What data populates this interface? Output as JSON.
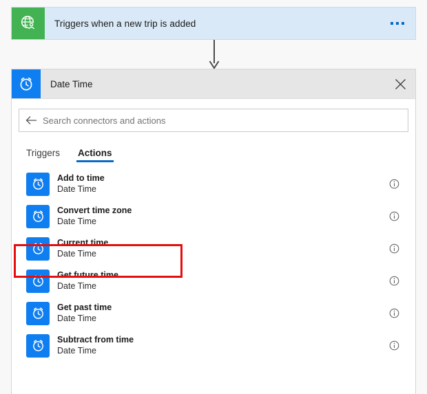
{
  "colors": {
    "trigger_card_bg": "#d9e9f7",
    "trigger_icon_bg": "#42b252",
    "connector_brand_blue": "#0f7ef0",
    "accent_blue": "#0a69c4",
    "annotation_red": "#e60d0d",
    "panel_header_bg": "#e6e6e6",
    "canvas_bg": "#f8f8f8"
  },
  "trigger": {
    "icon": "globe-person-icon",
    "title": "Triggers when a new trip is added",
    "menu_icon": "ellipsis-icon"
  },
  "connector": {
    "icon": "down-arrow-icon"
  },
  "panel": {
    "icon": "alarm-clock-icon",
    "title": "Date Time",
    "close_icon": "close-icon",
    "search": {
      "back_icon": "back-arrow-icon",
      "value": "",
      "placeholder": "Search connectors and actions"
    },
    "tabs": [
      {
        "label": "Triggers",
        "active": false
      },
      {
        "label": "Actions",
        "active": true
      }
    ],
    "actions": [
      {
        "name": "Add to time",
        "connector": "Date Time",
        "icon": "alarm-clock-icon",
        "info_icon": "info-icon",
        "highlighted": false
      },
      {
        "name": "Convert time zone",
        "connector": "Date Time",
        "icon": "alarm-clock-icon",
        "info_icon": "info-icon",
        "highlighted": false
      },
      {
        "name": "Current time",
        "connector": "Date Time",
        "icon": "alarm-clock-icon",
        "info_icon": "info-icon",
        "highlighted": true
      },
      {
        "name": "Get future time",
        "connector": "Date Time",
        "icon": "alarm-clock-icon",
        "info_icon": "info-icon",
        "highlighted": false
      },
      {
        "name": "Get past time",
        "connector": "Date Time",
        "icon": "alarm-clock-icon",
        "info_icon": "info-icon",
        "highlighted": false
      },
      {
        "name": "Subtract from time",
        "connector": "Date Time",
        "icon": "alarm-clock-icon",
        "info_icon": "info-icon",
        "highlighted": false
      }
    ]
  }
}
